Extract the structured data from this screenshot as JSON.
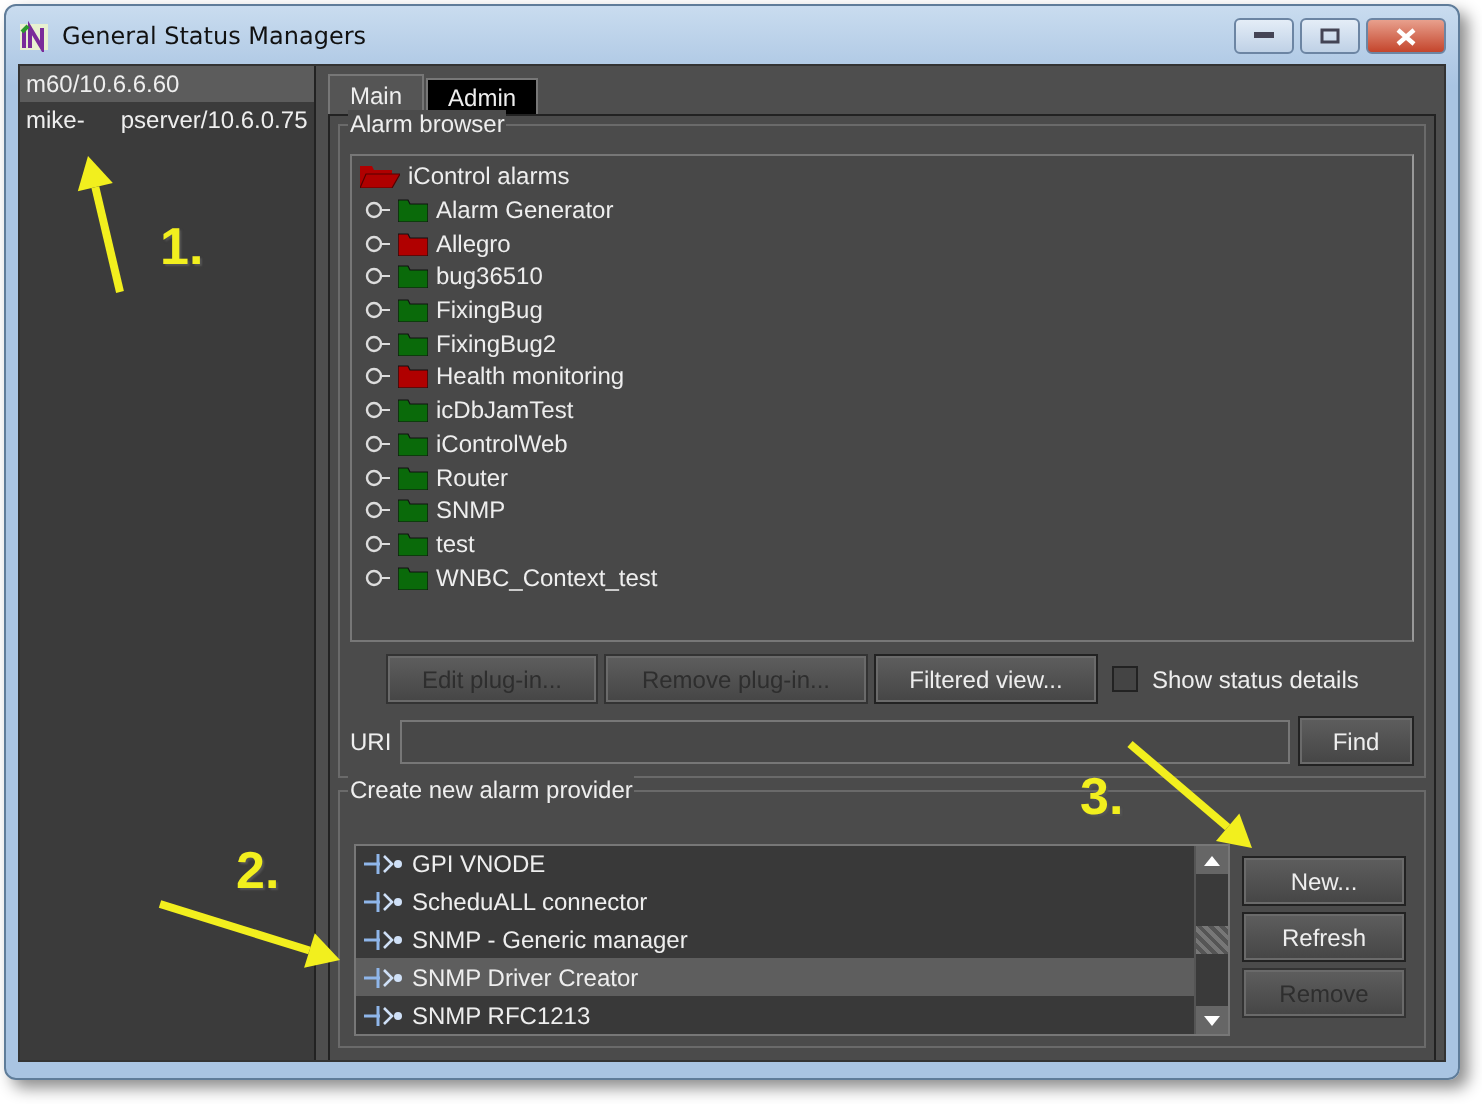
{
  "window": {
    "title": "General Status Managers"
  },
  "servers": [
    {
      "parts": [
        "m60/10.6.6.60"
      ],
      "selected": true
    },
    {
      "parts": [
        "mike-",
        "pserver/10.6.0.75"
      ],
      "selected": false
    }
  ],
  "tabs": [
    {
      "label": "Main",
      "selected": true
    },
    {
      "label": "Admin",
      "selected": false
    }
  ],
  "alarm_browser": {
    "title": "Alarm browser",
    "root": {
      "label": "iControl alarms",
      "color": "#b00000",
      "children": [
        {
          "label": "Alarm Generator",
          "color": "#0a6a0a"
        },
        {
          "label": "Allegro",
          "color": "#b00000"
        },
        {
          "label": "bug36510",
          "color": "#0a6a0a"
        },
        {
          "label": "FixingBug",
          "color": "#0a6a0a"
        },
        {
          "label": "FixingBug2",
          "color": "#0a6a0a"
        },
        {
          "label": "Health monitoring",
          "color": "#b00000"
        },
        {
          "label": "icDbJamTest",
          "color": "#0a6a0a"
        },
        {
          "label": "iControlWeb",
          "color": "#0a6a0a"
        },
        {
          "label": "Router",
          "color": "#0a6a0a"
        },
        {
          "label": "SNMP",
          "color": "#0a6a0a"
        },
        {
          "label": "test",
          "color": "#0a6a0a"
        },
        {
          "label": "WNBC_Context_test",
          "color": "#0a6a0a"
        }
      ]
    },
    "buttons": [
      {
        "label": "Edit plug-in...",
        "disabled": true
      },
      {
        "label": "Remove plug-in...",
        "disabled": true
      },
      {
        "label": "Filtered view...",
        "disabled": false
      }
    ],
    "show_status_details": {
      "label": "Show status details",
      "checked": false
    },
    "uri": {
      "label": "URI"
    },
    "find_button": "Find"
  },
  "provider": {
    "title": "Create new alarm provider",
    "items": [
      {
        "label": "GPI VNODE",
        "selected": false
      },
      {
        "label": "ScheduALL connector",
        "selected": false
      },
      {
        "label": "SNMP - Generic manager",
        "selected": false
      },
      {
        "label": "SNMP Driver Creator",
        "selected": true
      },
      {
        "label": "SNMP RFC1213",
        "selected": false
      }
    ],
    "buttons": [
      {
        "label": "New...",
        "disabled": false
      },
      {
        "label": "Refresh",
        "disabled": false
      },
      {
        "label": "Remove",
        "disabled": true
      }
    ]
  },
  "annotations": [
    {
      "label": "1."
    },
    {
      "label": "2."
    },
    {
      "label": "3."
    }
  ]
}
